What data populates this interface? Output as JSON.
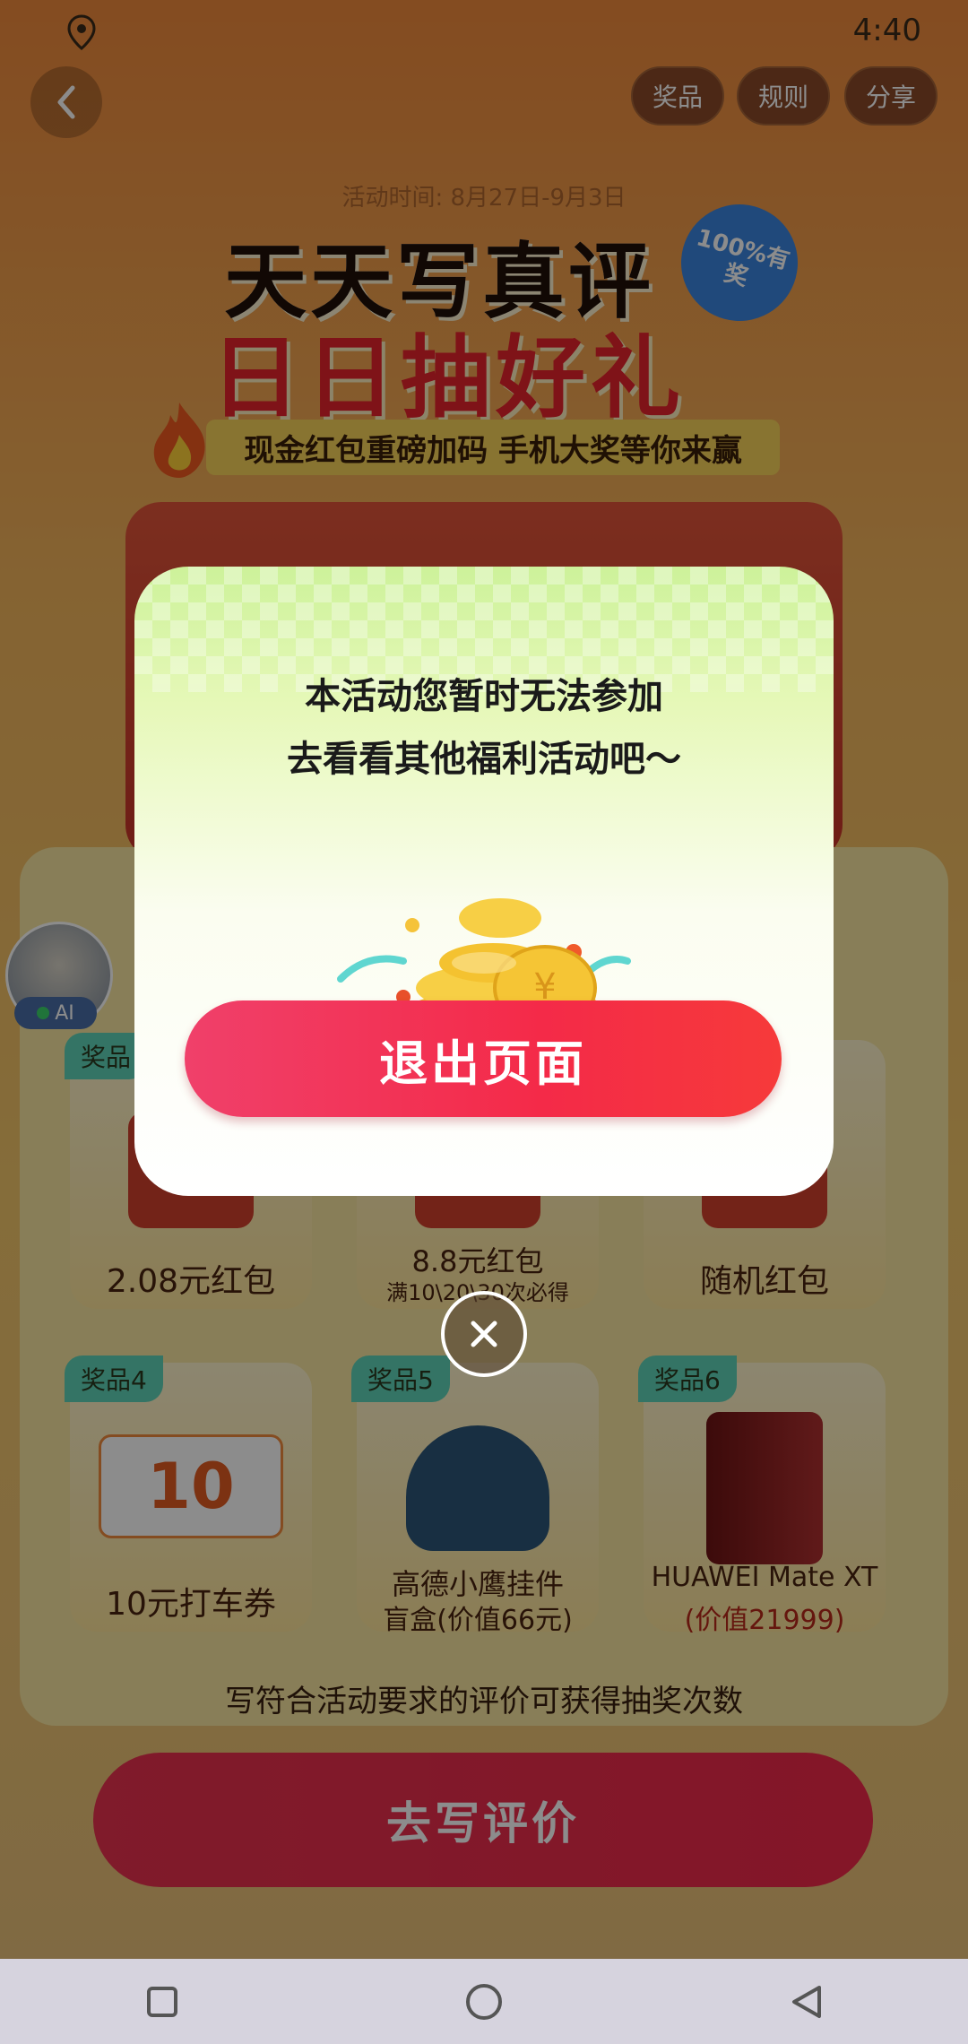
{
  "status_bar": {
    "time": "4:40",
    "location_icon": "location-pin-icon"
  },
  "header": {
    "back_icon": "chevron-left-icon",
    "chips": [
      {
        "label": "奖品"
      },
      {
        "label": "规则"
      },
      {
        "label": "分享"
      }
    ]
  },
  "hero": {
    "activity_time": "活动时间: 8月27日-9月3日",
    "title_line1": "天天写真评",
    "title_line2": "日日抽好礼",
    "badge": "100%有奖",
    "subtitle": "现金红包重磅加码 手机大奖等你来赢"
  },
  "prizes": [
    {
      "tag": "奖品",
      "name": "2.08元红包",
      "sub": ""
    },
    {
      "tag": "",
      "name": "8.8元红包",
      "sub": "满10\\20\\30次必得"
    },
    {
      "tag": "",
      "name": "随机红包",
      "sub": ""
    },
    {
      "tag": "奖品4",
      "name": "10元打车券",
      "sub": ""
    },
    {
      "tag": "奖品5",
      "name": "高德小鹰挂件",
      "sub": "盲盒(价值66元)"
    },
    {
      "tag": "奖品6",
      "name": "HUAWEI Mate XT",
      "sub": "(价值21999)"
    }
  ],
  "ticket_value": "10",
  "description": "写符合活动要求的评价可获得抽奖次数",
  "write_review_button": "去写评价",
  "ai_assistant": {
    "label": "AI"
  },
  "dialog": {
    "message_line1": "本活动您暂时无法参加",
    "message_line2": "去看看其他福利活动吧～",
    "exit_button": "退出页面",
    "close_icon": "close-icon"
  },
  "colors": {
    "accent_red": "#f42a48",
    "dialog_top": "#cdf29a",
    "page_bg": "#f3b55c"
  }
}
